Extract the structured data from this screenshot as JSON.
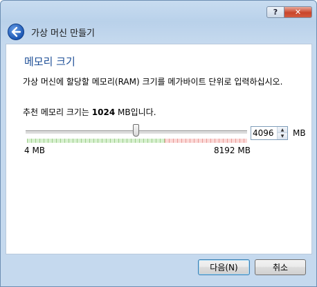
{
  "window": {
    "help_label": "?",
    "close_label": "✕"
  },
  "header": {
    "title": "가상 머신 만들기",
    "back_icon": "back-arrow-icon"
  },
  "page": {
    "title": "메모리 크기",
    "description": "가상 머신에 할당할 메모리(RAM) 크기를 메가바이트 단위로 입력하십시오.",
    "recommend_prefix": "추천 메모리 크기는 ",
    "recommend_value": "1024",
    "recommend_suffix": " MB입니다."
  },
  "memory": {
    "value": "4096",
    "unit": "MB",
    "min_label": "4 MB",
    "max_label": "8192 MB",
    "min": 4,
    "max": 8192,
    "current": 4096,
    "recommended_limit_fraction": 0.625
  },
  "buttons": {
    "next": "다음(N)",
    "cancel": "취소"
  },
  "colors": {
    "title": "#1e4f97",
    "safe": "#d7f0cf",
    "unsafe": "#fbd8d6"
  }
}
